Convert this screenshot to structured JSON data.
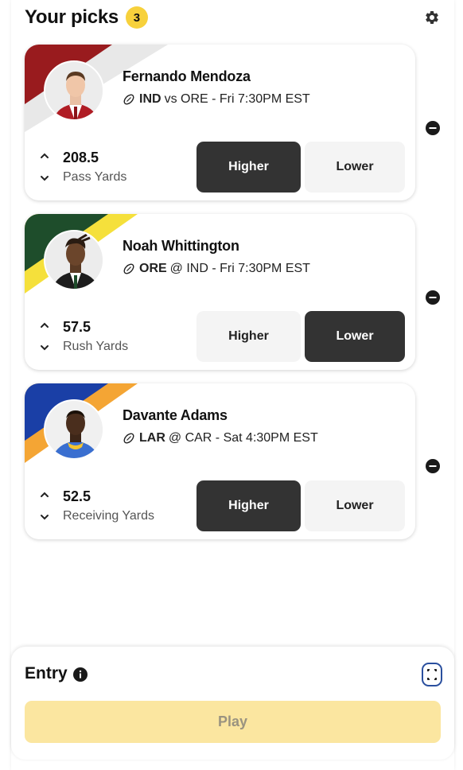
{
  "header": {
    "title": "Your picks",
    "count": "3"
  },
  "picks": [
    {
      "name": "Fernando Mendoza",
      "team": "IND",
      "matchup": "vs ORE - Fri 7:30PM EST",
      "line": "208.5",
      "stat": "Pass Yards",
      "higher_label": "Higher",
      "lower_label": "Lower",
      "selected": "higher",
      "band_colors": [
        "#991b1e",
        "#e8e8e8"
      ]
    },
    {
      "name": "Noah Whittington",
      "team": "ORE",
      "matchup": "@ IND - Fri 7:30PM EST",
      "line": "57.5",
      "stat": "Rush Yards",
      "higher_label": "Higher",
      "lower_label": "Lower",
      "selected": "lower",
      "band_colors": [
        "#1e4d2b",
        "#f5e03b"
      ]
    },
    {
      "name": "Davante Adams",
      "team": "LAR",
      "matchup": "@ CAR - Sat 4:30PM EST",
      "line": "52.5",
      "stat": "Receiving Yards",
      "higher_label": "Higher",
      "lower_label": "Lower",
      "selected": "higher",
      "band_colors": [
        "#1a3fa6",
        "#f4a534"
      ]
    }
  ],
  "entry": {
    "title": "Entry",
    "play_label": "Play"
  },
  "icons": {
    "gear": "gear-icon",
    "remove": "minus-circle-icon",
    "ball": "football-icon",
    "info": "info-icon",
    "expand": "expand-icon"
  },
  "colors": {
    "badge": "#f7d13c",
    "selected_button": "#333333",
    "unselected_button": "#f4f4f4",
    "play_button": "#fbe6a0",
    "expand_accent": "#2a4f9e"
  }
}
